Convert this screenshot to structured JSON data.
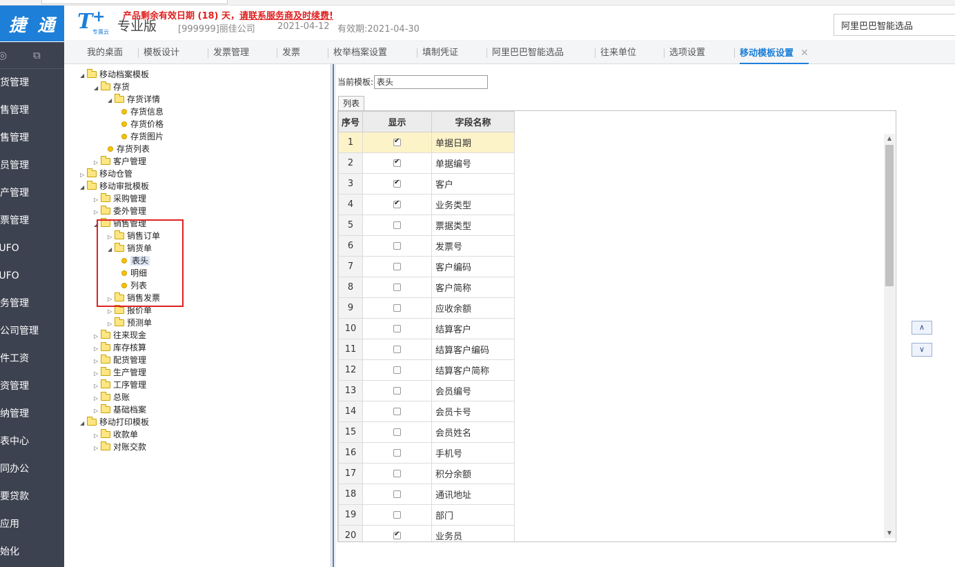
{
  "app": {
    "logo_text": "T+ 捷通",
    "brand_sub": "专属云",
    "edition": "专业版",
    "notice_prefix": "产品剩余有效日期 (18) 天，",
    "notice_link": "请联系服务商及时续费!",
    "company": "[999999]丽佳公司",
    "date": "2021-04-12",
    "valid_until": "有效期:2021-04-30",
    "search_value": "阿里巴巴智能选品"
  },
  "sidebar": {
    "icons": [
      "search-icon",
      "export-icon"
    ],
    "items": [
      "进货管理",
      "销售管理",
      "零售管理",
      "会员管理",
      "生产管理",
      "发票管理",
      "T-UFO",
      "T-UFO",
      "财务管理",
      "分公司管理",
      "计件工资",
      "工资管理",
      "出纳管理",
      "报表中心",
      "协同办公",
      "需要贷款",
      "云应用",
      "初始化"
    ]
  },
  "tabs": [
    {
      "label": "我的桌面"
    },
    {
      "label": "模板设计"
    },
    {
      "label": "发票管理"
    },
    {
      "label": "发票"
    },
    {
      "label": "枚举档案设置"
    },
    {
      "label": "填制凭证"
    },
    {
      "label": "阿里巴巴智能选品"
    },
    {
      "label": "往来单位"
    },
    {
      "label": "选项设置"
    },
    {
      "label": "移动模板设置",
      "active": true
    }
  ],
  "tree": [
    {
      "label": "移动档案模板",
      "level": 0,
      "type": "folder",
      "expanded": true
    },
    {
      "label": "存货",
      "level": 1,
      "type": "folder",
      "expanded": true
    },
    {
      "label": "存货详情",
      "level": 2,
      "type": "folder",
      "expanded": true
    },
    {
      "label": "存货信息",
      "level": 3,
      "type": "leaf"
    },
    {
      "label": "存货价格",
      "level": 3,
      "type": "leaf"
    },
    {
      "label": "存货图片",
      "level": 3,
      "type": "leaf"
    },
    {
      "label": "存货列表",
      "level": 2,
      "type": "leaf"
    },
    {
      "label": "客户管理",
      "level": 1,
      "type": "folder",
      "expanded": false
    },
    {
      "label": "移动仓管",
      "level": 0,
      "type": "folder",
      "expanded": false
    },
    {
      "label": "移动审批模板",
      "level": 0,
      "type": "folder",
      "expanded": true
    },
    {
      "label": "采购管理",
      "level": 1,
      "type": "folder",
      "expanded": false
    },
    {
      "label": "委外管理",
      "level": 1,
      "type": "folder",
      "expanded": false
    },
    {
      "label": "销售管理",
      "level": 1,
      "type": "folder",
      "expanded": true
    },
    {
      "label": "销售订单",
      "level": 2,
      "type": "folder",
      "expanded": false
    },
    {
      "label": "销货单",
      "level": 2,
      "type": "folder",
      "expanded": true
    },
    {
      "label": "表头",
      "level": 3,
      "type": "leaf",
      "selected": true
    },
    {
      "label": "明细",
      "level": 3,
      "type": "leaf"
    },
    {
      "label": "列表",
      "level": 3,
      "type": "leaf"
    },
    {
      "label": "销售发票",
      "level": 2,
      "type": "folder",
      "expanded": false
    },
    {
      "label": "报价单",
      "level": 2,
      "type": "folder",
      "expanded": false
    },
    {
      "label": "预测单",
      "level": 2,
      "type": "folder",
      "expanded": false
    },
    {
      "label": "往来现金",
      "level": 1,
      "type": "folder",
      "expanded": false
    },
    {
      "label": "库存核算",
      "level": 1,
      "type": "folder",
      "expanded": false
    },
    {
      "label": "配货管理",
      "level": 1,
      "type": "folder",
      "expanded": false
    },
    {
      "label": "生产管理",
      "level": 1,
      "type": "folder",
      "expanded": false
    },
    {
      "label": "工序管理",
      "level": 1,
      "type": "folder",
      "expanded": false
    },
    {
      "label": "总账",
      "level": 1,
      "type": "folder",
      "expanded": false
    },
    {
      "label": "基础档案",
      "level": 1,
      "type": "folder",
      "expanded": false
    },
    {
      "label": "移动打印模板",
      "level": 0,
      "type": "folder",
      "expanded": true
    },
    {
      "label": "收款单",
      "level": 1,
      "type": "folder",
      "expanded": false
    },
    {
      "label": "对账交款",
      "level": 1,
      "type": "folder",
      "expanded": false
    }
  ],
  "editor": {
    "template_label": "当前模板:",
    "template_value": "表头",
    "list_tab": "列表",
    "columns": [
      "序号",
      "显示",
      "字段名称"
    ],
    "rows": [
      {
        "no": "1",
        "show": true,
        "name": "单据日期"
      },
      {
        "no": "2",
        "show": true,
        "name": "单据编号"
      },
      {
        "no": "3",
        "show": true,
        "name": "客户"
      },
      {
        "no": "4",
        "show": true,
        "name": "业务类型"
      },
      {
        "no": "5",
        "show": false,
        "name": "票据类型"
      },
      {
        "no": "6",
        "show": false,
        "name": "发票号"
      },
      {
        "no": "7",
        "show": false,
        "name": "客户编码"
      },
      {
        "no": "8",
        "show": false,
        "name": "客户简称"
      },
      {
        "no": "9",
        "show": false,
        "name": "应收余额"
      },
      {
        "no": "10",
        "show": false,
        "name": "结算客户"
      },
      {
        "no": "11",
        "show": false,
        "name": "结算客户编码"
      },
      {
        "no": "12",
        "show": false,
        "name": "结算客户简称"
      },
      {
        "no": "13",
        "show": false,
        "name": "会员编号"
      },
      {
        "no": "14",
        "show": false,
        "name": "会员卡号"
      },
      {
        "no": "15",
        "show": false,
        "name": "会员姓名"
      },
      {
        "no": "16",
        "show": false,
        "name": "手机号"
      },
      {
        "no": "17",
        "show": false,
        "name": "积分余额"
      },
      {
        "no": "18",
        "show": false,
        "name": "通讯地址"
      },
      {
        "no": "19",
        "show": false,
        "name": "部门"
      },
      {
        "no": "20",
        "show": true,
        "name": "业务员"
      }
    ],
    "move_up": "∧",
    "move_down": "∨"
  }
}
